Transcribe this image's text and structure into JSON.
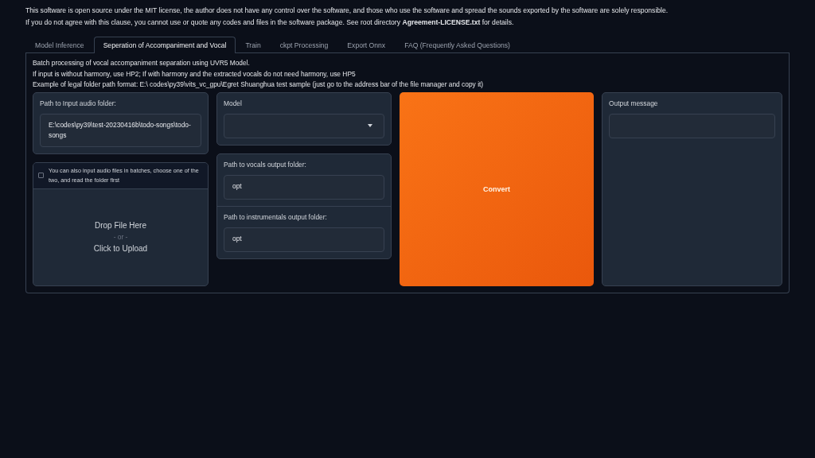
{
  "notice": [
    "This software is open source under the MIT license, the author does not have any control over the software, and those who use the software and spread the sounds exported by the software are solely responsible.",
    "If you do not agree with this clause, you cannot use or quote any codes and files in the software package. See root directory **Agreement-LICENSE.txt** for details."
  ],
  "tabs": [
    {
      "label": "Model Inference",
      "selected": false
    },
    {
      "label": "Seperation of Accompaniment and Vocal",
      "selected": true
    },
    {
      "label": "Train",
      "selected": false
    },
    {
      "label": "ckpt Processing",
      "selected": false
    },
    {
      "label": "Export Onnx",
      "selected": false
    },
    {
      "label": "FAQ (Frequently Asked Questions)",
      "selected": false
    }
  ],
  "description": [
    "Batch processing of vocal accompaniment separation using UVR5 Model.",
    "If input is without harmony, use HP2; If with harmony and the extracted vocals do not need harmony, use HP5",
    "Example of legal folder path format: E:\\ codes\\py39\\vits_vc_gpu\\Egret Shuanghua test sample (just go to the address bar of the file manager and copy it)"
  ],
  "input_folder": {
    "label": "Path to Input audio folder:",
    "value": "E:\\codes\\py39\\test-20230416b\\todo-songs\\todo-songs"
  },
  "batch_upload": {
    "label": "You can also input audio files in batches, choose one of the two, and read the folder first",
    "checked": false,
    "drop_text": "Drop File Here",
    "or_text": "- or -",
    "click_text": "Click to Upload"
  },
  "model": {
    "label": "Model"
  },
  "vocals_folder": {
    "label": "Path to vocals output folder:",
    "value": "opt"
  },
  "instrumentals_folder": {
    "label": "Path to instrumentals output folder:",
    "value": "opt"
  },
  "convert_button": "Convert",
  "output": {
    "label": "Output message"
  }
}
